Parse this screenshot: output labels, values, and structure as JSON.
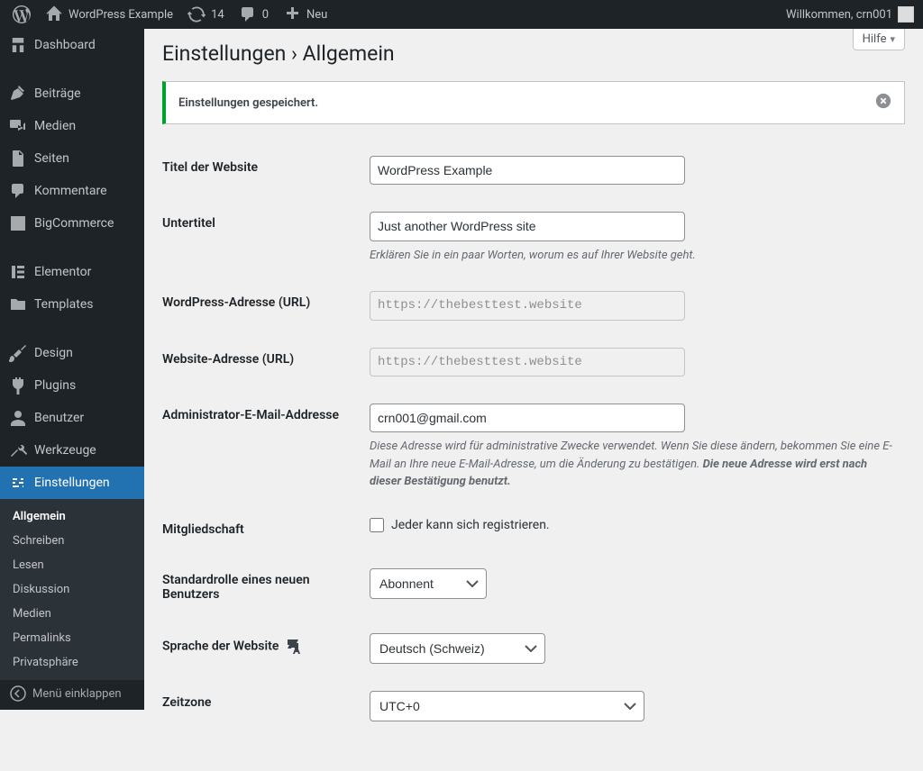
{
  "adminbar": {
    "site_title": "WordPress Example",
    "updates": "14",
    "comments": "0",
    "new": "Neu",
    "welcome": "Willkommen, crn001"
  },
  "sidebar": {
    "dashboard": "Dashboard",
    "posts": "Beiträge",
    "media": "Medien",
    "pages": "Seiten",
    "comments": "Kommentare",
    "bigcommerce": "BigCommerce",
    "elementor": "Elementor",
    "templates": "Templates",
    "design": "Design",
    "plugins": "Plugins",
    "users": "Benutzer",
    "tools": "Werkzeuge",
    "settings": "Einstellungen",
    "submenu": {
      "general": "Allgemein",
      "writing": "Schreiben",
      "reading": "Lesen",
      "discussion": "Diskussion",
      "media": "Medien",
      "permalinks": "Permalinks",
      "privacy": "Privatsphäre"
    },
    "collapse": "Menü einklappen"
  },
  "page": {
    "help": "Hilfe",
    "title": "Einstellungen › Allgemein",
    "notice": "Einstellungen gespeichert."
  },
  "form": {
    "site_title_label": "Titel der Website",
    "site_title_value": "WordPress Example",
    "tagline_label": "Untertitel",
    "tagline_value": "Just another WordPress site",
    "tagline_desc": "Erklären Sie in ein paar Worten, worum es auf Ihrer Website geht.",
    "wpurl_label": "WordPress-Adresse (URL)",
    "wpurl_value": "https://thebesttest.website",
    "siteurl_label": "Website-Adresse (URL)",
    "siteurl_value": "https://thebesttest.website",
    "admin_email_label": "Administrator-E-Mail-Addresse",
    "admin_email_value": "crn001@gmail.com",
    "admin_email_desc_1": "Diese Adresse wird für administrative Zwecke verwendet. Wenn Sie diese ändern, bekommen Sie eine E-Mail an Ihre neue E-Mail-Adresse, um die Änderung zu bestätigen. ",
    "admin_email_desc_2": "Die neue Adresse wird erst nach dieser Bestätigung benutzt.",
    "membership_label": "Mitgliedschaft",
    "membership_option": "Jeder kann sich registrieren.",
    "default_role_label": "Standardrolle eines neuen Benutzers",
    "default_role_value": "Abonnent",
    "language_label": "Sprache der Website",
    "language_value": "Deutsch (Schweiz)",
    "timezone_label": "Zeitzone",
    "timezone_value": "UTC+0"
  }
}
